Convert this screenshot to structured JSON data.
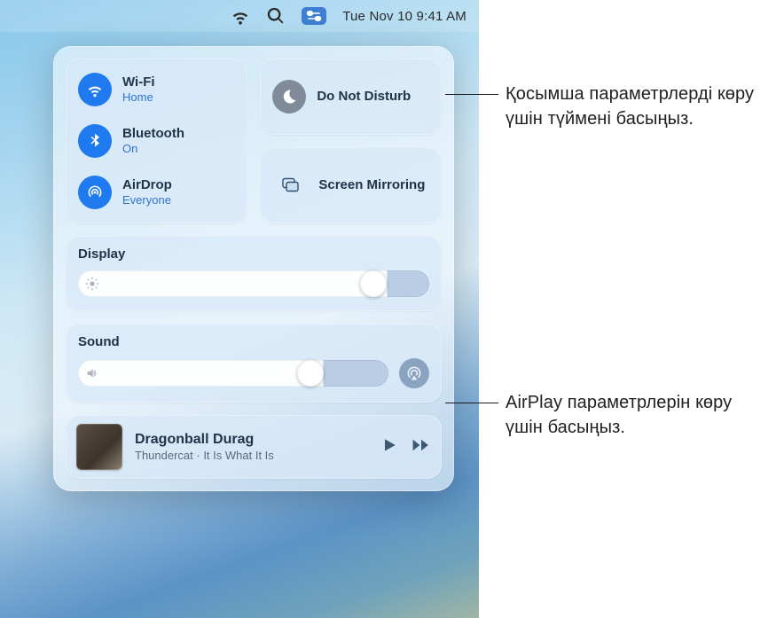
{
  "menubar": {
    "datetime": "Tue Nov 10  9:41 AM"
  },
  "control_center": {
    "wifi": {
      "label": "Wi-Fi",
      "status": "Home"
    },
    "bluetooth": {
      "label": "Bluetooth",
      "status": "On"
    },
    "airdrop": {
      "label": "AirDrop",
      "status": "Everyone"
    },
    "dnd": {
      "label": "Do Not Disturb"
    },
    "mirroring": {
      "label": "Screen Mirroring"
    },
    "display": {
      "label": "Display",
      "value_pct": 88
    },
    "sound": {
      "label": "Sound",
      "value_pct": 79
    },
    "now_playing": {
      "title": "Dragonball Durag",
      "subtitle": "Thundercat · It Is What It Is"
    }
  },
  "callouts": {
    "dnd": "Қосымша параметрлерді көру үшін түймені басыңыз.",
    "airplay": "AirPlay параметрлерін көру үшін басыңыз."
  }
}
